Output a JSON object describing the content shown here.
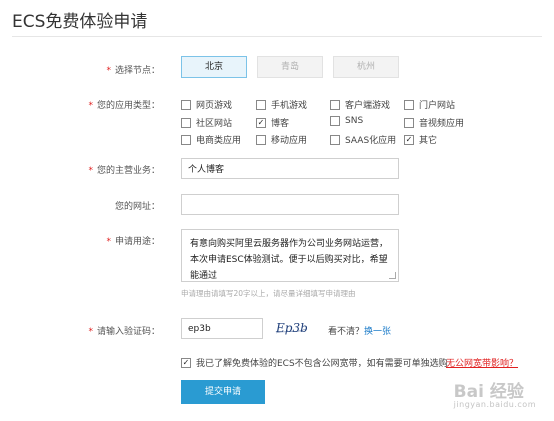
{
  "page": {
    "title": "ECS免费体验申请"
  },
  "node": {
    "label": "选择节点：",
    "options": [
      "北京",
      "青岛",
      "杭州"
    ],
    "selected": "北京"
  },
  "app_type": {
    "label": "您的应用类型：",
    "options": [
      {
        "label": "网页游戏",
        "checked": false
      },
      {
        "label": "手机游戏",
        "checked": false
      },
      {
        "label": "客户端游戏",
        "checked": false
      },
      {
        "label": "门户网站",
        "checked": false
      },
      {
        "label": "社区网站",
        "checked": false
      },
      {
        "label": "博客",
        "checked": true
      },
      {
        "label": "SNS",
        "checked": false
      },
      {
        "label": "音视频应用",
        "checked": false
      },
      {
        "label": "电商类应用",
        "checked": false
      },
      {
        "label": "移动应用",
        "checked": false
      },
      {
        "label": "SAAS化应用",
        "checked": false
      },
      {
        "label": "其它",
        "checked": true
      }
    ]
  },
  "main_business": {
    "label": "您的主营业务：",
    "value": "个人博客"
  },
  "website": {
    "label": "您的网址：",
    "value": ""
  },
  "purpose": {
    "label": "申请用途：",
    "value": "有意向购买阿里云服务器作为公司业务网站运营，本次申请ESC体验测试。便于以后购买对比，希望能通过",
    "hint": "申请理由请填写20字以上，请尽量详细填写申请理由"
  },
  "captcha": {
    "label": "请输入验证码：",
    "value": "ep3b",
    "image_text": "Ep3b",
    "cant_see": "看不清？",
    "refresh": "换一张"
  },
  "agreement": {
    "checked": true,
    "text": "我已了解免费体验的ECS不包含公网宽带，如有需要可单独选购",
    "link": "无公网宽带影响？"
  },
  "submit": {
    "label": "提交申请"
  },
  "watermark": {
    "main": "Bai 经验",
    "sub": "jingyan.baidu.com"
  },
  "colors": {
    "primary": "#2a9bd2",
    "required": "#e02020",
    "link": "#1a7ac8"
  }
}
